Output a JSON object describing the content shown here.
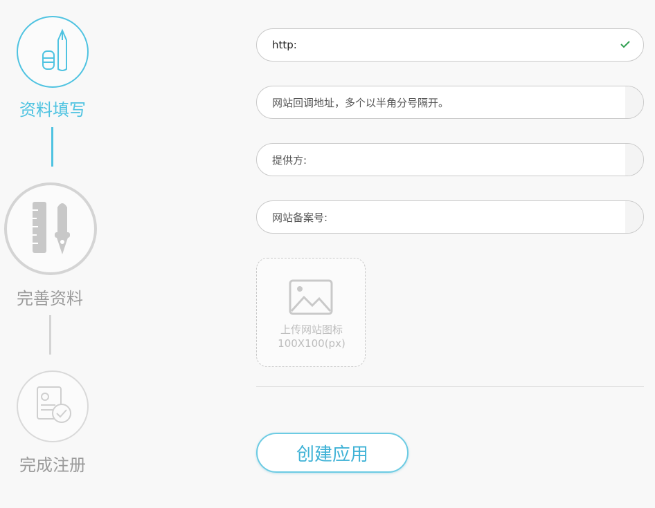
{
  "steps": [
    {
      "label": "资料填写",
      "state": "active",
      "icon": "pencil-eraser-icon"
    },
    {
      "label": "完善资料",
      "state": "pending",
      "icon": "ruler-pen-icon"
    },
    {
      "label": "完成注册",
      "state": "pending",
      "icon": "document-check-icon"
    }
  ],
  "colors": {
    "active": "#4fc3e1",
    "inactive": "#d4d4d4",
    "inactive_text": "#9a9a9a",
    "check": "#2e9e4f"
  },
  "form": {
    "url_value": "http:",
    "callback_placeholder": "网站回调地址，多个以半角分号隔开。",
    "provider_placeholder": "提供方:",
    "icp_placeholder": "网站备案号:",
    "upload_line1": "上传网站图标",
    "upload_line2": "100X100(px)",
    "submit_label": "创建应用"
  }
}
